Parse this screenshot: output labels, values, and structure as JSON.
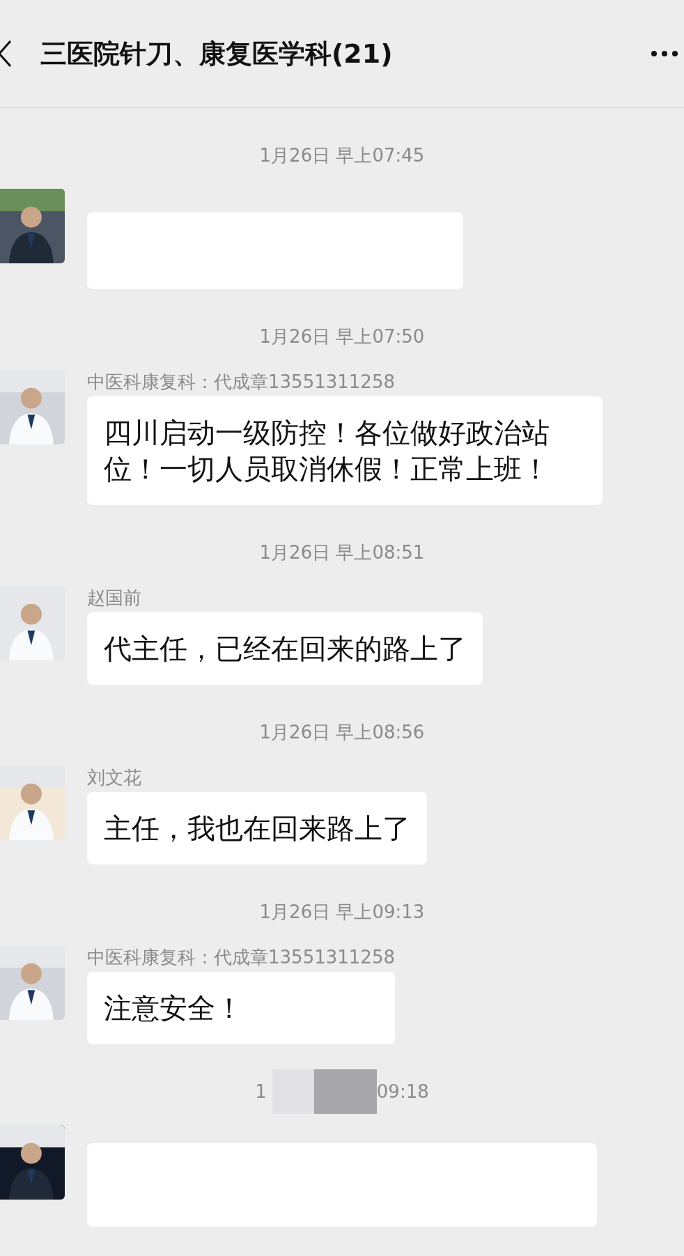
{
  "header": {
    "title": "三医院针刀、康复医学科(21)"
  },
  "messages": [
    {
      "time": {
        "text": "1月26日 早上07:45"
      },
      "kind": "redacted"
    },
    {
      "time": {
        "text": "1月26日 早上07:50"
      },
      "sender": "中医科康复科：代成章13551311258",
      "kind": "text",
      "text": "四川启动一级防控！各位做好政治站位！一切人员取消休假！正常上班！"
    },
    {
      "time": {
        "text": "1月26日 早上08:51"
      },
      "sender": "赵国前",
      "kind": "text",
      "text": "代主任，已经在回来的路上了"
    },
    {
      "time": {
        "text": "1月26日 早上08:56"
      },
      "sender": "刘文花",
      "kind": "text",
      "text": "主任，我也在回来路上了"
    },
    {
      "time": {
        "text": "1月26日 早上09:13"
      },
      "sender": "中医科康复科：代成章13551311258",
      "kind": "text",
      "text": "注意安全！"
    },
    {
      "time": {
        "prefix": "1",
        "suffix": "09:18"
      },
      "kind": "cut"
    }
  ]
}
